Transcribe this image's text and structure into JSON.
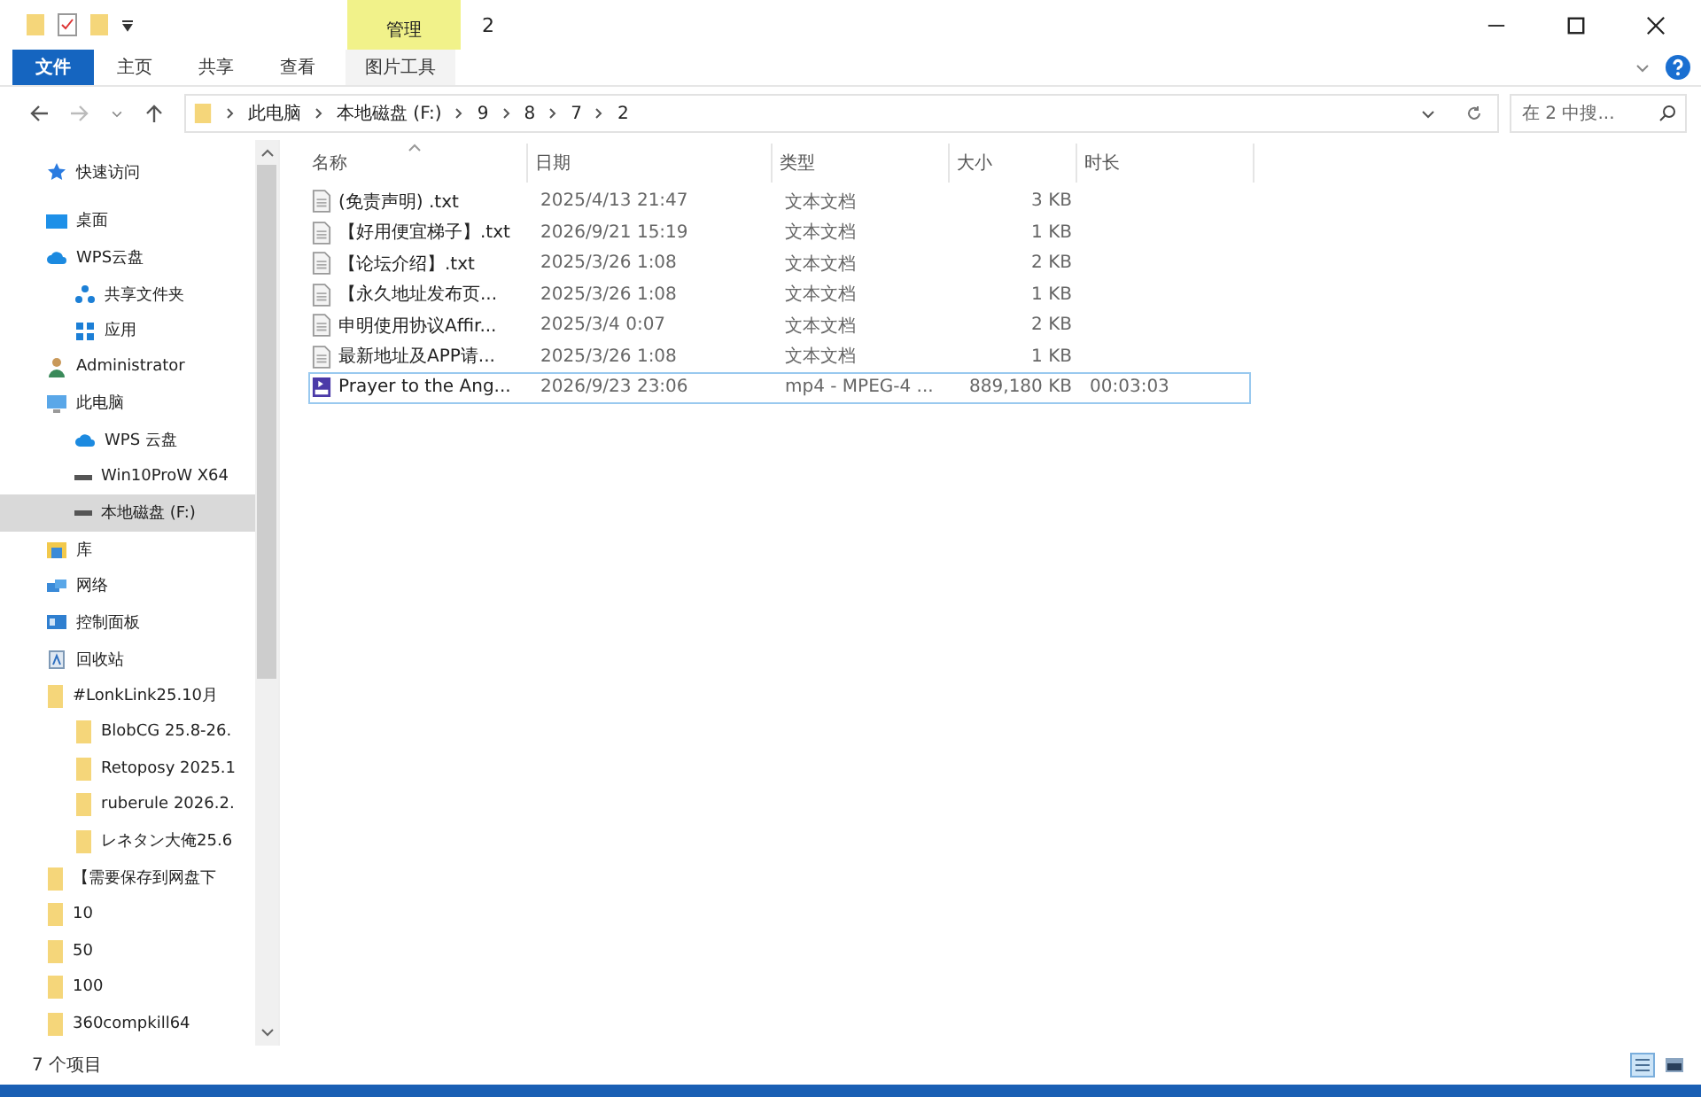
{
  "window": {
    "title": "2",
    "context_tab": "管理"
  },
  "ribbon_tabs": [
    {
      "label": "文件",
      "selected": true,
      "kind": "file"
    },
    {
      "label": "主页",
      "selected": false,
      "kind": "tab"
    },
    {
      "label": "共享",
      "selected": false,
      "kind": "tab"
    },
    {
      "label": "查看",
      "selected": false,
      "kind": "tab"
    },
    {
      "label": "图片工具",
      "selected": false,
      "kind": "context"
    }
  ],
  "address": {
    "path": [
      "此电脑",
      "本地磁盘 (F:)",
      "9",
      "8",
      "7",
      "2"
    ]
  },
  "search": {
    "placeholder": "在 2 中搜..."
  },
  "sidebar": {
    "items": [
      {
        "label": "快速访问",
        "kind": "star",
        "selected": false
      },
      {
        "label": "桌面",
        "kind": "desktop",
        "selected": false,
        "children": [
          {
            "label": "WPS云盘",
            "kind": "cloud",
            "selected": false,
            "children": [
              {
                "label": "共享文件夹",
                "kind": "share",
                "selected": false
              },
              {
                "label": "应用",
                "kind": "apps",
                "selected": false
              }
            ]
          },
          {
            "label": "Administrator",
            "kind": "user",
            "selected": false
          },
          {
            "label": "此电脑",
            "kind": "pc",
            "selected": false,
            "children": [
              {
                "label": "WPS 云盘",
                "kind": "cloud",
                "selected": false
              },
              {
                "label": "Win10ProW X64",
                "kind": "drive",
                "selected": false
              },
              {
                "label": "本地磁盘 (F:)",
                "kind": "drive",
                "selected": true
              }
            ]
          },
          {
            "label": "库",
            "kind": "library",
            "selected": false
          },
          {
            "label": "网络",
            "kind": "network",
            "selected": false
          },
          {
            "label": "控制面板",
            "kind": "control",
            "selected": false
          },
          {
            "label": "回收站",
            "kind": "recycle",
            "selected": false
          },
          {
            "label": "#LonkLink25.10月",
            "kind": "folder",
            "selected": false,
            "children": [
              {
                "label": "BlobCG 25.8-26.",
                "kind": "folder",
                "selected": false
              },
              {
                "label": "Retoposy 2025.1",
                "kind": "folder",
                "selected": false
              },
              {
                "label": "ruberule 2026.2.",
                "kind": "folder",
                "selected": false
              },
              {
                "label": "レネタン大俺25.6",
                "kind": "folder",
                "selected": false
              }
            ]
          },
          {
            "label": "【需要保存到网盘下",
            "kind": "folder",
            "selected": false
          },
          {
            "label": "10",
            "kind": "folder",
            "selected": false
          },
          {
            "label": "50",
            "kind": "folder",
            "selected": false
          },
          {
            "label": "100",
            "kind": "folder",
            "selected": false
          },
          {
            "label": "360compkill64",
            "kind": "folder",
            "selected": false
          }
        ]
      }
    ]
  },
  "table": {
    "columns": [
      "名称",
      "日期",
      "类型",
      "大小",
      "时长"
    ],
    "rows": [
      {
        "kind": "text",
        "selected": false,
        "cells": [
          "(免责声明) .txt",
          "2025/4/13 21:47",
          "文本文档",
          "3 KB"
        ]
      },
      {
        "kind": "text",
        "selected": false,
        "cells": [
          "【好用便宜梯子】.txt",
          "2026/9/21 15:19",
          "文本文档",
          "1 KB"
        ]
      },
      {
        "kind": "text",
        "selected": false,
        "cells": [
          "【论坛介绍】.txt",
          "2025/3/26 1:08",
          "文本文档",
          "2 KB"
        ]
      },
      {
        "kind": "text",
        "selected": false,
        "cells": [
          "【永久地址发布页...",
          "2025/3/26 1:08",
          "文本文档",
          "1 KB"
        ]
      },
      {
        "kind": "text",
        "selected": false,
        "cells": [
          "申明使用协议Affir...",
          "2025/3/4 0:07",
          "文本文档",
          "2 KB"
        ]
      },
      {
        "kind": "text",
        "selected": false,
        "cells": [
          "最新地址及APP请...",
          "2025/3/26 1:08",
          "文本文档",
          "1 KB"
        ]
      },
      {
        "kind": "video",
        "selected": true,
        "cells": [
          "Prayer to the Ang...",
          "2026/9/23 23:06",
          "mp4 - MPEG-4 ...",
          "889,180 KB",
          "00:03:03"
        ]
      }
    ]
  },
  "status_bar": {
    "text": "7 个项目"
  }
}
